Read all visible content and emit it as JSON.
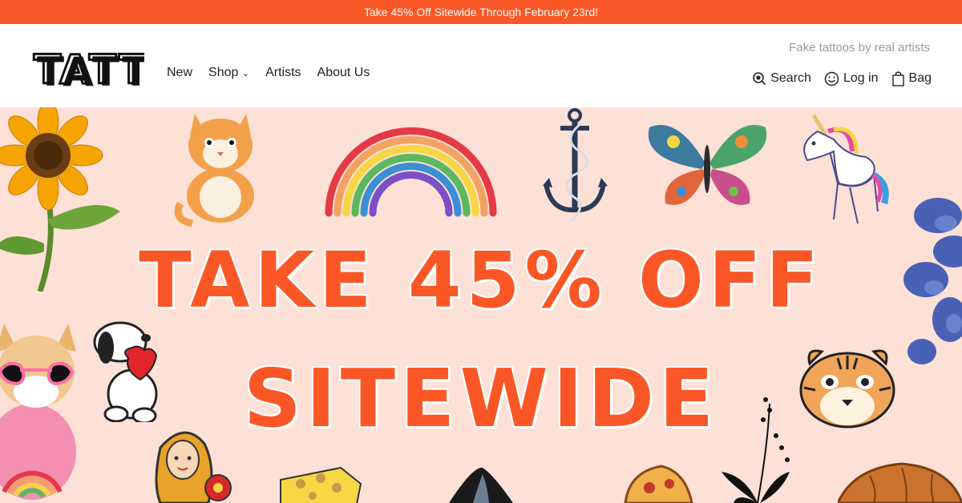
{
  "promo": {
    "text": "Take 45% Off Sitewide Through February 23rd!"
  },
  "header": {
    "logo_text": "TATTLY",
    "nav": {
      "new": "New",
      "shop": "Shop",
      "artists": "Artists",
      "about": "About Us"
    },
    "tagline": "Fake tattoos by real artists",
    "utility": {
      "search": "Search",
      "login": "Log in",
      "bag": "Bag"
    }
  },
  "hero": {
    "headline_line1": "TAKE 45% OFF",
    "headline_line2": "SITEWIDE"
  },
  "colors": {
    "brand": "#fb5726",
    "hero_bg": "#fde0d6"
  }
}
